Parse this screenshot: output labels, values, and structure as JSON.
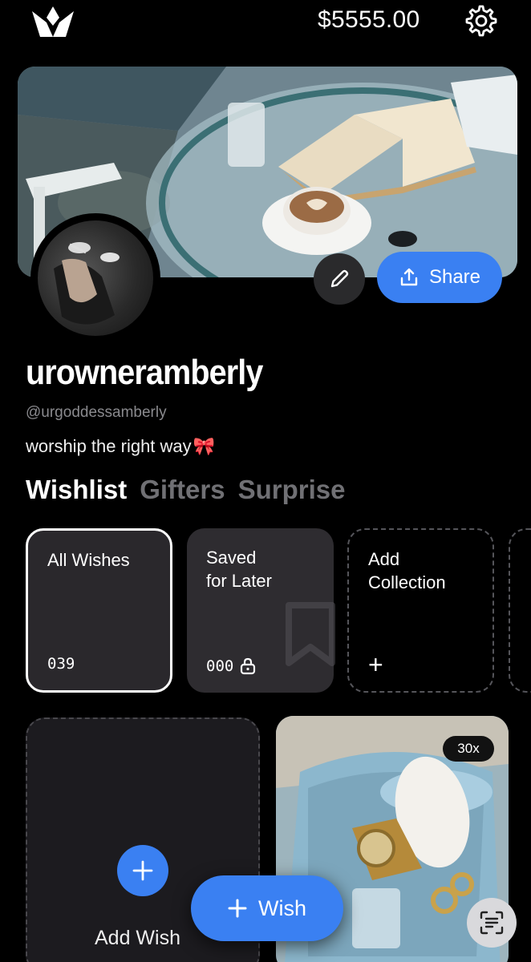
{
  "header": {
    "balance": "$5555.00",
    "logo_icon": "crown-lotus-logo",
    "settings_icon": "gear-icon"
  },
  "profile": {
    "cover_image": "cafe-book-coffee-photo",
    "avatar_image": "profile-photo",
    "share_label": "Share",
    "username": "urowneramberly",
    "handle": "@urgoddessamberly",
    "bio": "worship the right way",
    "bio_emoji": "🎀"
  },
  "tabs": [
    {
      "label": "Wishlist",
      "active": true
    },
    {
      "label": "Gifters",
      "active": false
    },
    {
      "label": "Surprise",
      "active": false
    }
  ],
  "collections": [
    {
      "title_line1": "All Wishes",
      "title_line2": "",
      "count": "039"
    },
    {
      "title_line1": "Saved",
      "title_line2": "for Later",
      "count": "000"
    },
    {
      "title_line1": "Add",
      "title_line2": "Collection",
      "count": "+"
    }
  ],
  "wishes": {
    "add_label": "Add Wish",
    "product_qty": "30x",
    "fab_label": "Wish"
  },
  "colors": {
    "accent": "#3a80f2",
    "background": "#000000",
    "card": "#2a282c"
  }
}
